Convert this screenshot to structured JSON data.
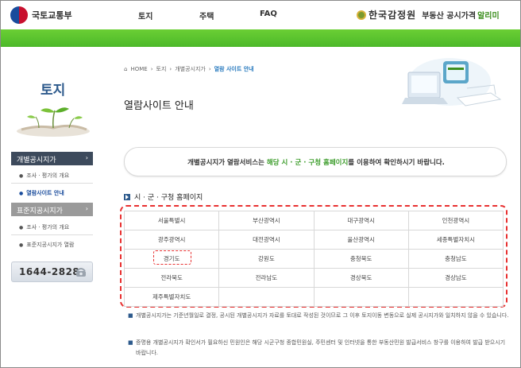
{
  "header": {
    "logo_text": "국토교통부",
    "nav": [
      "토지",
      "주택",
      "FAQ"
    ],
    "brand_name": "한국감정원",
    "brand_sub": "부동산 공시가격",
    "brand_sub2": "알리미"
  },
  "sidebar": {
    "title": "토지",
    "menu1": {
      "label": "개별공시지가",
      "arrow": "›"
    },
    "menu1_items": [
      {
        "label": "조사 · 평가의 개요"
      },
      {
        "label": "열람사이트 안내"
      }
    ],
    "menu2": {
      "label": "표준지공시지가",
      "arrow": "›"
    },
    "menu2_items": [
      {
        "label": "조사 · 평가의 개요"
      },
      {
        "label": "표준지공시지가 열람"
      }
    ],
    "phone": "1644-2828"
  },
  "breadcrumb": [
    "HOME",
    "토지",
    "개별공시지가",
    "열람 사이트 안내"
  ],
  "page_title": "열람사이트 안내",
  "notice": {
    "pre": "개별공시지가 열람서비스는 ",
    "highlight": "해당 시 · 군 · 구청 홈페이지",
    "post": "를 이용하여 확인하시기 바랍니다."
  },
  "section_title": "시 · 군 · 구청 홈페이지",
  "cities": [
    [
      "서울특별시",
      "부산광역시",
      "대구광역시",
      "인천광역시"
    ],
    [
      "광주광역시",
      "대전광역시",
      "울산광역시",
      "세종특별자치시"
    ],
    [
      "경기도",
      "강원도",
      "충청북도",
      "충청남도"
    ],
    [
      "전라북도",
      "전라남도",
      "경상북도",
      "경상남도"
    ],
    [
      "제주특별자치도",
      "",
      "",
      ""
    ]
  ],
  "notes": [
    "개별공시지가는 기준년월일로 결정, 공시된 개별공시지가 자료를 토대로 작성된 것이므로 그 이후 토지이동 변동으로 실제 공시지가와 일치하지 않을 수 있습니다.",
    "증명용 개별공시지가 확인서가 필요하신 민원인은 해당 시군구청 종합민원실, 주민센터 및 인터넷을 통한 부동산민원 발급서비스 창구를 이용하여 발급 받으시기 바랍니다."
  ],
  "colors": {
    "accent_green": "#4cb82a",
    "navy": "#2d5a8c",
    "highlight_red": "#e83030"
  }
}
